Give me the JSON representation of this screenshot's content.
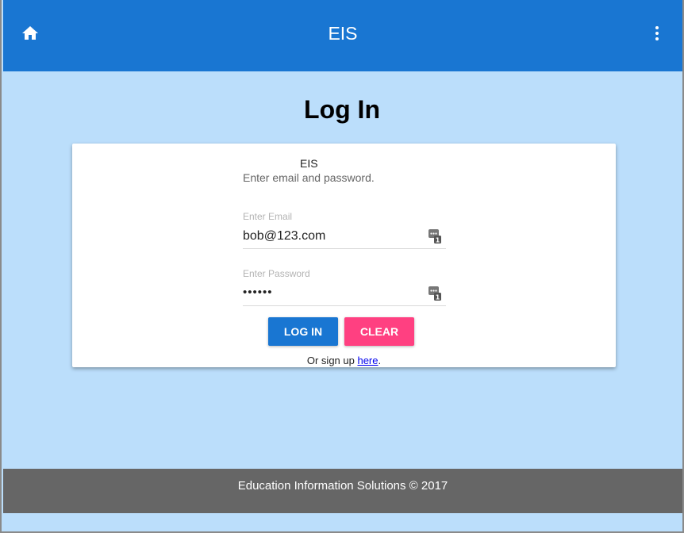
{
  "appbar": {
    "title": "EIS",
    "home_icon": "home-icon",
    "menu_icon": "more-vert-icon",
    "color": "#1976d2"
  },
  "page": {
    "title": "Log In",
    "background": "#bbdefb"
  },
  "card": {
    "app_name": "EIS",
    "subtitle": "Enter email and password."
  },
  "form": {
    "email": {
      "label": "Enter Email",
      "value": "bob@123.com",
      "icon": "password-manager-key-icon"
    },
    "password": {
      "label": "Enter Password",
      "value": "••••••",
      "icon": "password-manager-key-icon"
    },
    "login_label": "LOG IN",
    "clear_label": "CLEAR",
    "login_color": "#1976d2",
    "clear_color": "#ff4081"
  },
  "signup": {
    "prefix": "Or sign up ",
    "link_text": "here",
    "suffix": "."
  },
  "footer": {
    "text": "Education Information Solutions © 2017"
  }
}
